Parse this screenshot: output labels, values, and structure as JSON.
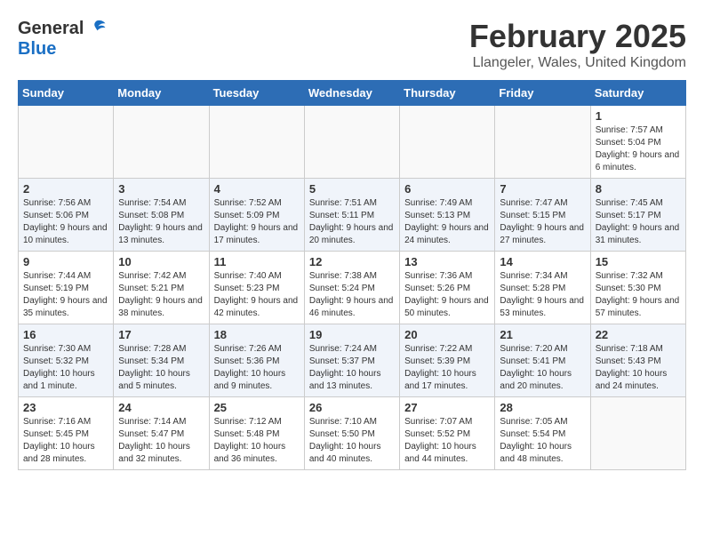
{
  "logo": {
    "general": "General",
    "blue": "Blue"
  },
  "title": "February 2025",
  "subtitle": "Llangeler, Wales, United Kingdom",
  "headers": [
    "Sunday",
    "Monday",
    "Tuesday",
    "Wednesday",
    "Thursday",
    "Friday",
    "Saturday"
  ],
  "weeks": [
    [
      {
        "day": "",
        "info": ""
      },
      {
        "day": "",
        "info": ""
      },
      {
        "day": "",
        "info": ""
      },
      {
        "day": "",
        "info": ""
      },
      {
        "day": "",
        "info": ""
      },
      {
        "day": "",
        "info": ""
      },
      {
        "day": "1",
        "info": "Sunrise: 7:57 AM\nSunset: 5:04 PM\nDaylight: 9 hours and 6 minutes."
      }
    ],
    [
      {
        "day": "2",
        "info": "Sunrise: 7:56 AM\nSunset: 5:06 PM\nDaylight: 9 hours and 10 minutes."
      },
      {
        "day": "3",
        "info": "Sunrise: 7:54 AM\nSunset: 5:08 PM\nDaylight: 9 hours and 13 minutes."
      },
      {
        "day": "4",
        "info": "Sunrise: 7:52 AM\nSunset: 5:09 PM\nDaylight: 9 hours and 17 minutes."
      },
      {
        "day": "5",
        "info": "Sunrise: 7:51 AM\nSunset: 5:11 PM\nDaylight: 9 hours and 20 minutes."
      },
      {
        "day": "6",
        "info": "Sunrise: 7:49 AM\nSunset: 5:13 PM\nDaylight: 9 hours and 24 minutes."
      },
      {
        "day": "7",
        "info": "Sunrise: 7:47 AM\nSunset: 5:15 PM\nDaylight: 9 hours and 27 minutes."
      },
      {
        "day": "8",
        "info": "Sunrise: 7:45 AM\nSunset: 5:17 PM\nDaylight: 9 hours and 31 minutes."
      }
    ],
    [
      {
        "day": "9",
        "info": "Sunrise: 7:44 AM\nSunset: 5:19 PM\nDaylight: 9 hours and 35 minutes."
      },
      {
        "day": "10",
        "info": "Sunrise: 7:42 AM\nSunset: 5:21 PM\nDaylight: 9 hours and 38 minutes."
      },
      {
        "day": "11",
        "info": "Sunrise: 7:40 AM\nSunset: 5:23 PM\nDaylight: 9 hours and 42 minutes."
      },
      {
        "day": "12",
        "info": "Sunrise: 7:38 AM\nSunset: 5:24 PM\nDaylight: 9 hours and 46 minutes."
      },
      {
        "day": "13",
        "info": "Sunrise: 7:36 AM\nSunset: 5:26 PM\nDaylight: 9 hours and 50 minutes."
      },
      {
        "day": "14",
        "info": "Sunrise: 7:34 AM\nSunset: 5:28 PM\nDaylight: 9 hours and 53 minutes."
      },
      {
        "day": "15",
        "info": "Sunrise: 7:32 AM\nSunset: 5:30 PM\nDaylight: 9 hours and 57 minutes."
      }
    ],
    [
      {
        "day": "16",
        "info": "Sunrise: 7:30 AM\nSunset: 5:32 PM\nDaylight: 10 hours and 1 minute."
      },
      {
        "day": "17",
        "info": "Sunrise: 7:28 AM\nSunset: 5:34 PM\nDaylight: 10 hours and 5 minutes."
      },
      {
        "day": "18",
        "info": "Sunrise: 7:26 AM\nSunset: 5:36 PM\nDaylight: 10 hours and 9 minutes."
      },
      {
        "day": "19",
        "info": "Sunrise: 7:24 AM\nSunset: 5:37 PM\nDaylight: 10 hours and 13 minutes."
      },
      {
        "day": "20",
        "info": "Sunrise: 7:22 AM\nSunset: 5:39 PM\nDaylight: 10 hours and 17 minutes."
      },
      {
        "day": "21",
        "info": "Sunrise: 7:20 AM\nSunset: 5:41 PM\nDaylight: 10 hours and 20 minutes."
      },
      {
        "day": "22",
        "info": "Sunrise: 7:18 AM\nSunset: 5:43 PM\nDaylight: 10 hours and 24 minutes."
      }
    ],
    [
      {
        "day": "23",
        "info": "Sunrise: 7:16 AM\nSunset: 5:45 PM\nDaylight: 10 hours and 28 minutes."
      },
      {
        "day": "24",
        "info": "Sunrise: 7:14 AM\nSunset: 5:47 PM\nDaylight: 10 hours and 32 minutes."
      },
      {
        "day": "25",
        "info": "Sunrise: 7:12 AM\nSunset: 5:48 PM\nDaylight: 10 hours and 36 minutes."
      },
      {
        "day": "26",
        "info": "Sunrise: 7:10 AM\nSunset: 5:50 PM\nDaylight: 10 hours and 40 minutes."
      },
      {
        "day": "27",
        "info": "Sunrise: 7:07 AM\nSunset: 5:52 PM\nDaylight: 10 hours and 44 minutes."
      },
      {
        "day": "28",
        "info": "Sunrise: 7:05 AM\nSunset: 5:54 PM\nDaylight: 10 hours and 48 minutes."
      },
      {
        "day": "",
        "info": ""
      }
    ]
  ]
}
